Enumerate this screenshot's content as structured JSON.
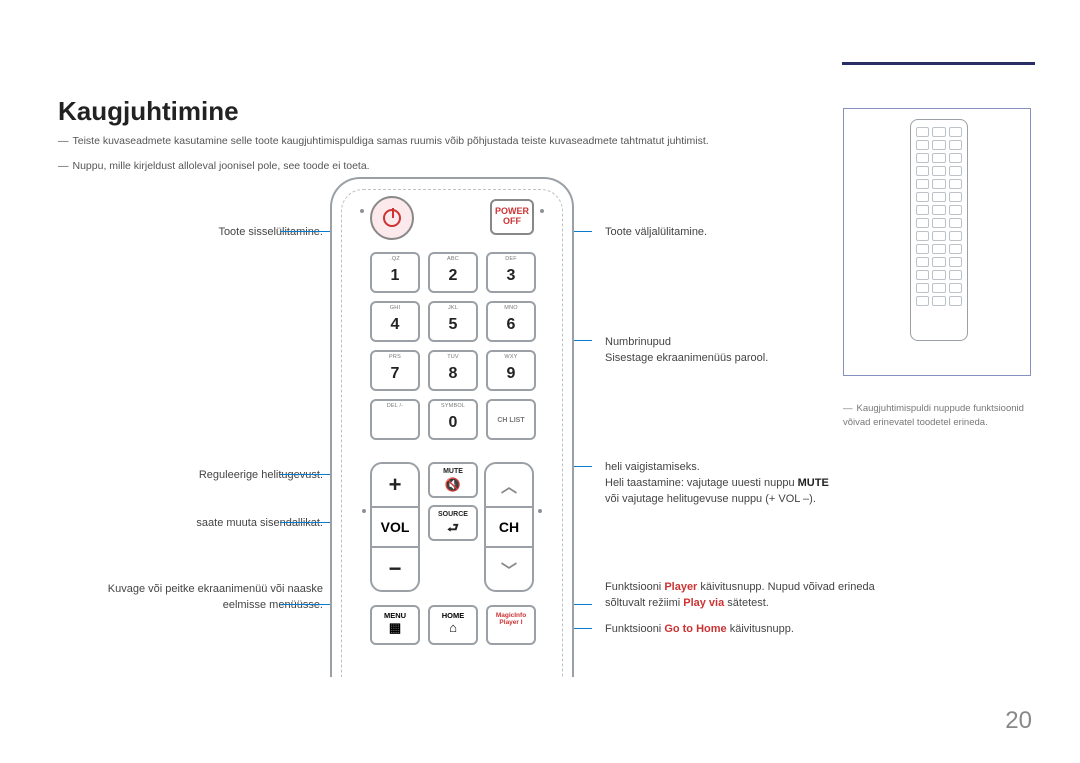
{
  "pageNumber": "20",
  "title": "Kaugjuhtimine",
  "notes": [
    "Teiste kuvaseadmete kasutamine selle toote kaugjuhtimispuldiga samas ruumis võib põhjustada teiste kuvaseadmete tahtmatut juhtimist.",
    "Nuppu, mille kirjeldust alloleval joonisel pole, see toode ei toeta."
  ],
  "left": {
    "powerOn": "Toote sisselülitamine.",
    "volume": "Reguleerige helitugevust.",
    "source": "saate muuta sisendallikat.",
    "menu": "Kuvage või peitke ekraanimenüü või naaske eelmisse menüüsse."
  },
  "right": {
    "powerOff": "Toote väljalülitamine.",
    "numbers1": "Numbrinupud",
    "numbers2": "Sisestage ekraanimenüüs parool.",
    "mute1": "heli vaigistamiseks.",
    "mute2a": "Heli taastamine: vajutage uuesti nuppu ",
    "mute2b": "MUTE",
    "mute3": "või vajutage helitugevuse nuppu (+ VOL –).",
    "player1": "Funktsiooni ",
    "player2": "Player",
    "player3": " käivitusnupp. Nupud võivad erineda sõltuvalt režiimi ",
    "player4": "Play via",
    "player5": " sätetest.",
    "home1": "Funktsiooni ",
    "home2": "Go to Home",
    "home3": " käivitusnupp."
  },
  "refNote": "Kaugjuhtimispuldi nuppude funktsioonid võivad erinevatel toodetel erineda.",
  "remote": {
    "powerOff": "POWER\nOFF",
    "keys": [
      {
        "sub": ".QZ",
        "main": "1"
      },
      {
        "sub": "ABC",
        "main": "2"
      },
      {
        "sub": "DEF",
        "main": "3"
      },
      {
        "sub": "GHI",
        "main": "4"
      },
      {
        "sub": "JKL",
        "main": "5"
      },
      {
        "sub": "MNO",
        "main": "6"
      },
      {
        "sub": "PRS",
        "main": "7"
      },
      {
        "sub": "TUV",
        "main": "8"
      },
      {
        "sub": "WXY",
        "main": "9"
      },
      {
        "sub": "DEL /-",
        "main": ""
      },
      {
        "sub": "SYMBOL",
        "main": "0"
      },
      {
        "sub": "",
        "main": "CH LIST"
      }
    ],
    "vol": "VOL",
    "ch": "CH",
    "mute": "MUTE",
    "sourceLbl": "SOURCE",
    "menu": "MENU",
    "home": "HOME",
    "magic": "MagicInfo\nPlayer I"
  }
}
